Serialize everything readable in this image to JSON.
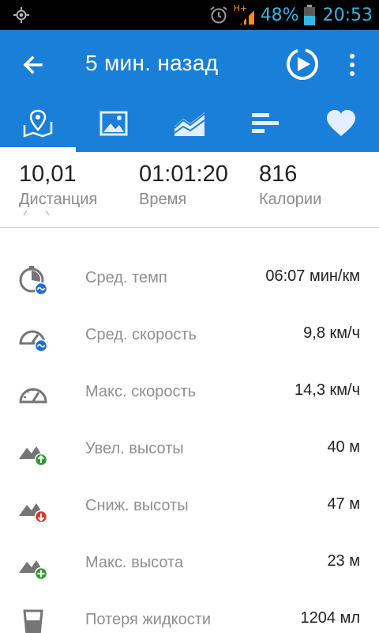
{
  "status_bar": {
    "network": "H+",
    "battery_percent": "48%",
    "time": "20:53"
  },
  "app_bar": {
    "title": "5 мин. назад"
  },
  "tabs": [
    {
      "icon": "map-icon",
      "active": true
    },
    {
      "icon": "photo-icon",
      "active": false
    },
    {
      "icon": "chart-icon",
      "active": false
    },
    {
      "icon": "bars-icon",
      "active": false
    },
    {
      "icon": "heart-icon",
      "active": false
    }
  ],
  "summary": {
    "distance": {
      "value": "10,01",
      "label": "Дистанция"
    },
    "time": {
      "value": "01:01:20",
      "label": "Время"
    },
    "calories": {
      "value": "816",
      "label": "Калории"
    }
  },
  "stats": [
    {
      "icon": "pace-icon",
      "label": "Сред. темп",
      "value": "06:07 мин/км"
    },
    {
      "icon": "avg-speed-icon",
      "label": "Сред. скорость",
      "value": "9,8 км/ч"
    },
    {
      "icon": "max-speed-icon",
      "label": "Макс. скорость",
      "value": "14,3 км/ч"
    },
    {
      "icon": "ascent-icon",
      "label": "Увел. высоты",
      "value": "40 м"
    },
    {
      "icon": "descent-icon",
      "label": "Сниж. высоты",
      "value": "47 м"
    },
    {
      "icon": "max-altitude-icon",
      "label": "Макс. высота",
      "value": "23 м"
    },
    {
      "icon": "water-icon",
      "label": "Потеря жидкости",
      "value": "1204 мл"
    }
  ],
  "colors": {
    "primary": "#1a7fd8",
    "status_text": "#33b5e5",
    "icon_gray": "#757575",
    "badge_blue": "#1e6fd0",
    "badge_green": "#2e9b2e",
    "badge_red": "#d93a2b"
  }
}
